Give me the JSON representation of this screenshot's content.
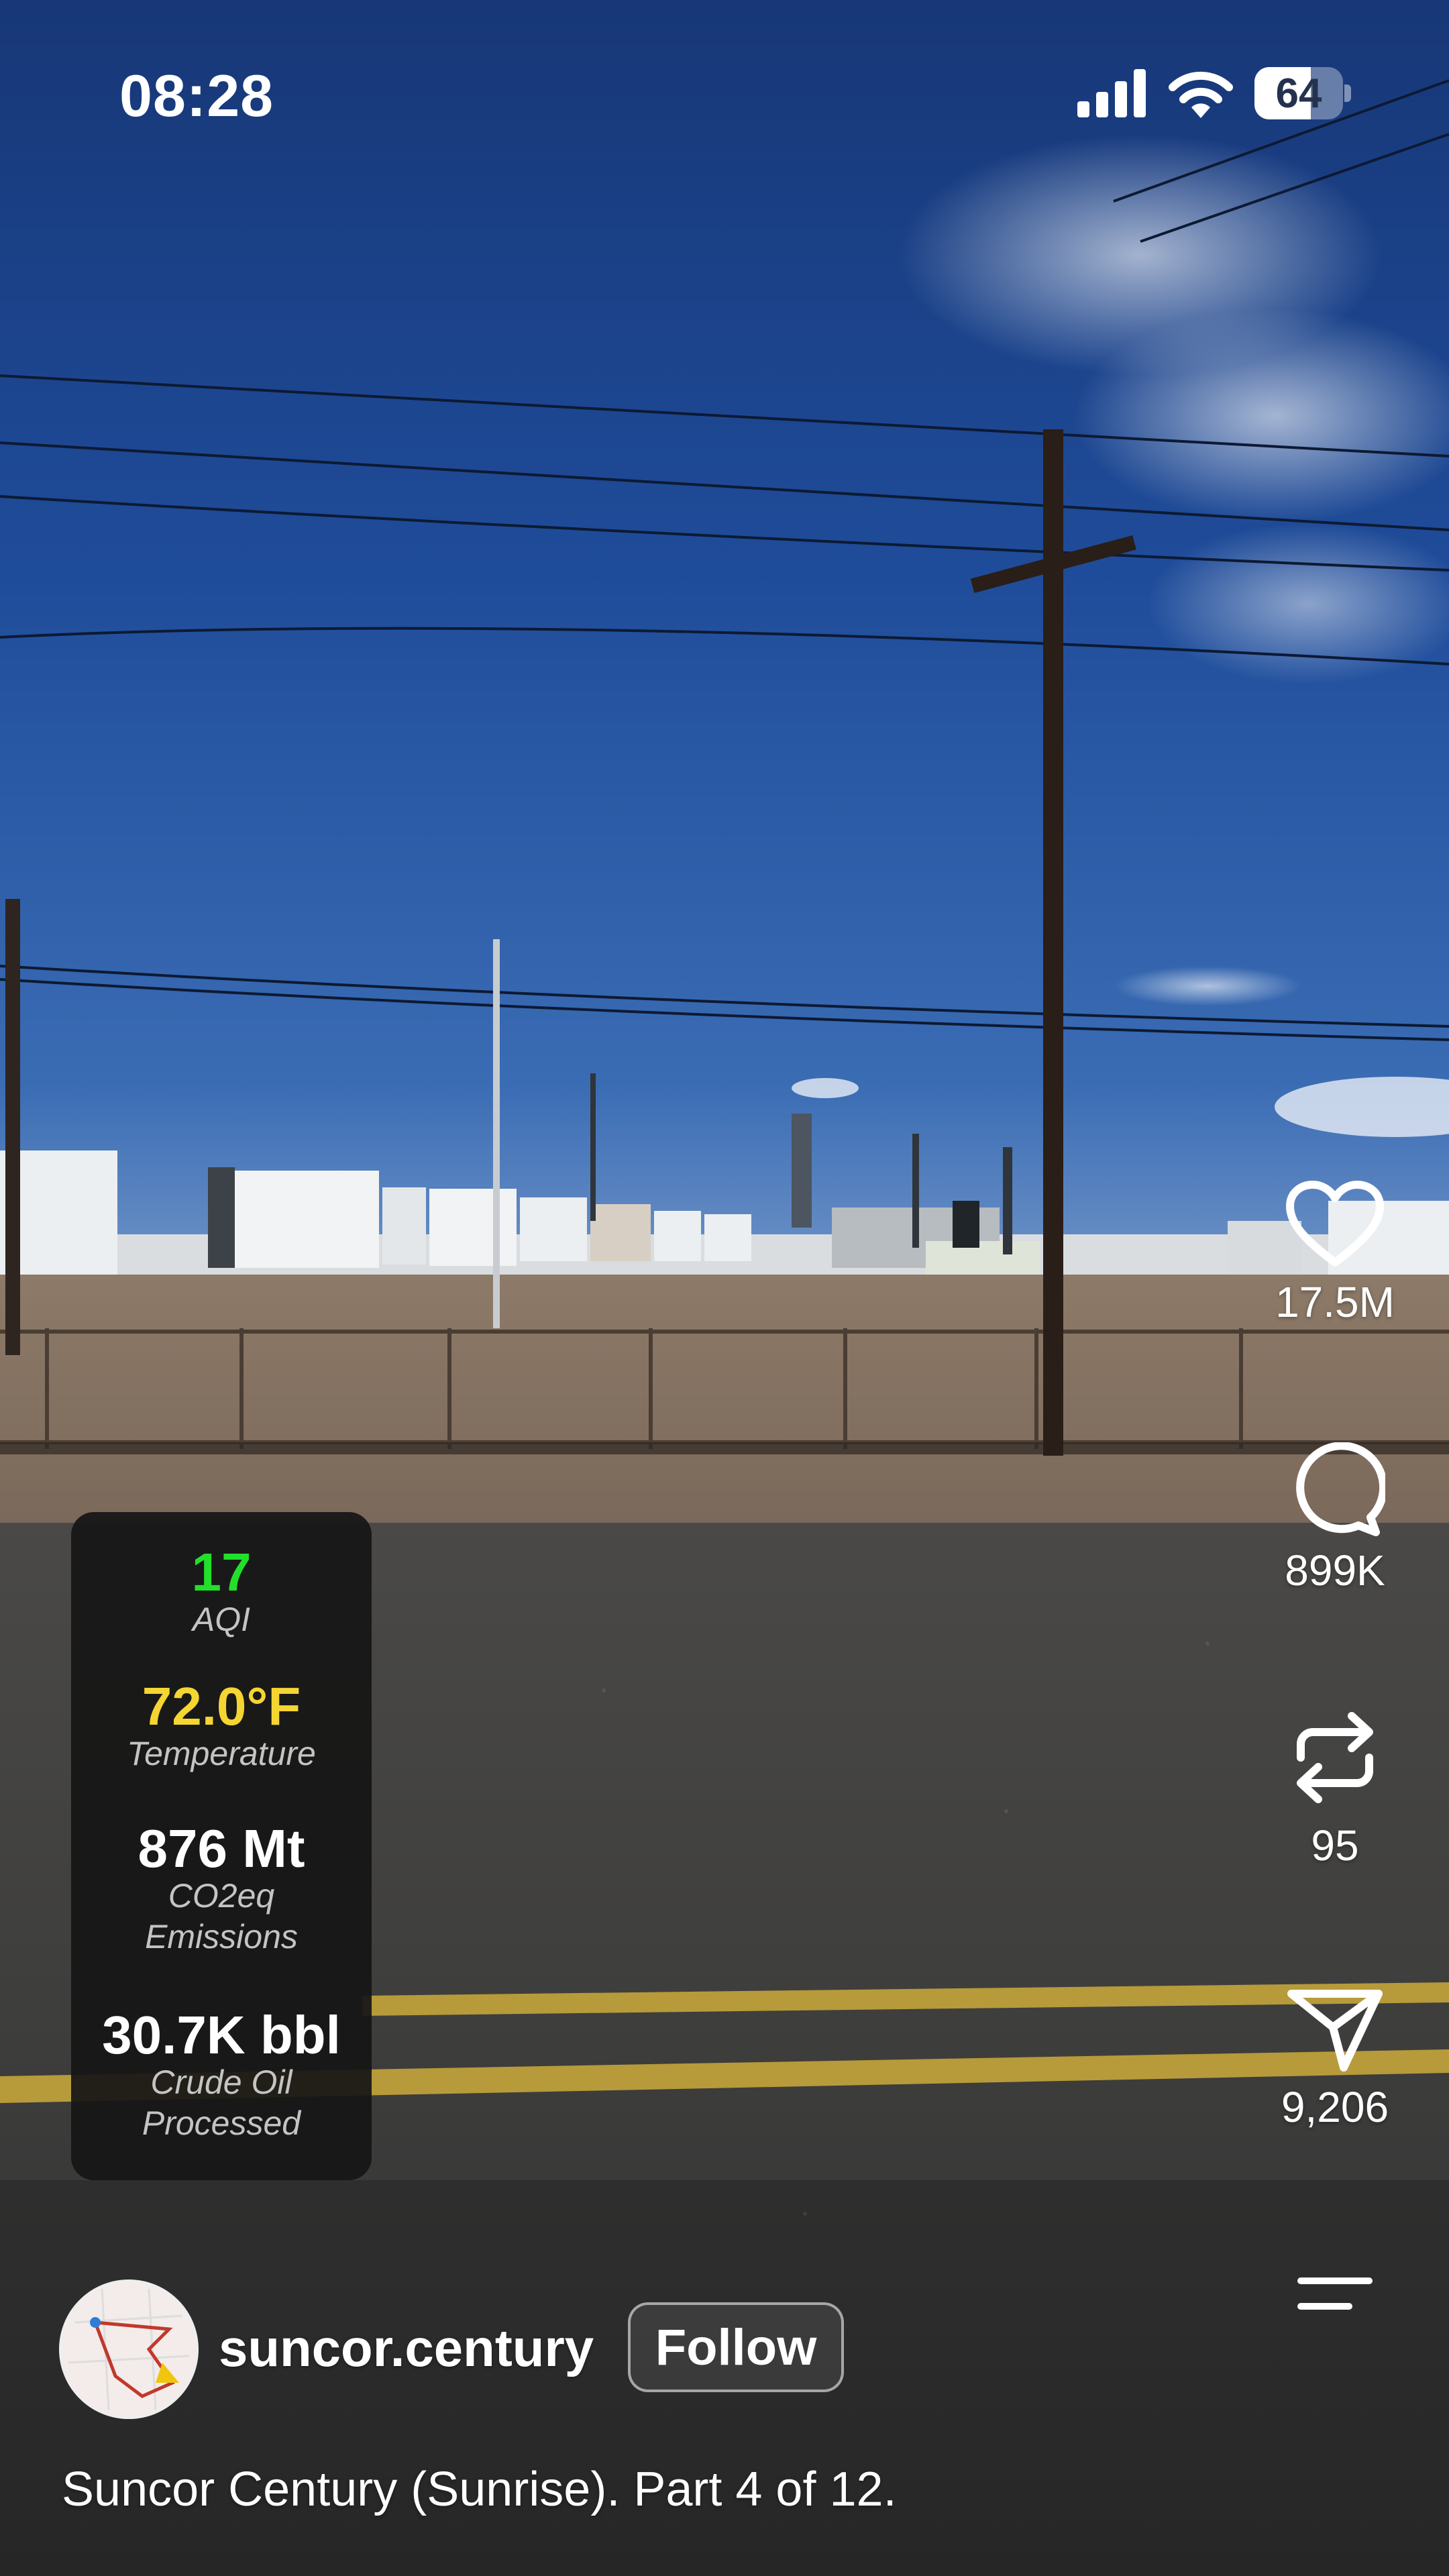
{
  "status_bar": {
    "time": "08:28",
    "battery": "64",
    "battery_level": 0.64
  },
  "video": {
    "description": "Scene shows an oil refinery with white storage tanks behind a chain-link fence, under a deep blue sky with wispy clouds and power lines, viewed from a cracked asphalt road with double yellow center lines."
  },
  "stats": [
    {
      "value": "17",
      "label": "AQI",
      "color": "#22e02a"
    },
    {
      "value": "72.0°F",
      "label": "Temperature",
      "color": "#f5d532"
    },
    {
      "value": "876 Mt",
      "label_line1": "CO2eq",
      "label_line2": "Emissions",
      "color": "#ffffff"
    },
    {
      "value": "30.7K bbl",
      "label_line1": "Crude Oil",
      "label_line2": "Processed",
      "color": "#ffffff"
    }
  ],
  "actions": {
    "like_count": "17.5M",
    "comment_count": "899K",
    "repost_count": "95",
    "share_count": "9,206"
  },
  "icons": [
    "heart-icon",
    "comment-icon",
    "repost-icon",
    "share-icon",
    "menu-icon",
    "signal-icon",
    "wifi-icon",
    "battery-icon"
  ],
  "user": {
    "username": "suncor.century",
    "follow_label": "Follow"
  },
  "caption": "Suncor Century (Sunrise). Part 4 of 12."
}
